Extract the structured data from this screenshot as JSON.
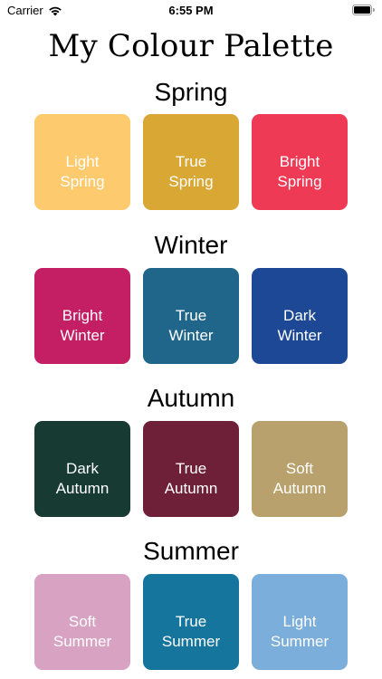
{
  "status_bar": {
    "carrier": "Carrier",
    "time": "6:55 PM",
    "icons": [
      "wifi-icon",
      "battery-icon"
    ]
  },
  "title": "My Colour Palette",
  "seasons": [
    {
      "name": "Spring",
      "swatches": [
        {
          "line1": "Light",
          "line2": "Spring",
          "color": "#FDCA6E"
        },
        {
          "line1": "True",
          "line2": "Spring",
          "color": "#D8A734"
        },
        {
          "line1": "Bright",
          "line2": "Spring",
          "color": "#EE3A55"
        }
      ]
    },
    {
      "name": "Winter",
      "swatches": [
        {
          "line1": "Bright",
          "line2": "Winter",
          "color": "#C41E64"
        },
        {
          "line1": "True",
          "line2": "Winter",
          "color": "#20668A"
        },
        {
          "line1": "Dark",
          "line2": "Winter",
          "color": "#1D4896"
        }
      ]
    },
    {
      "name": "Autumn",
      "swatches": [
        {
          "line1": "Dark",
          "line2": "Autumn",
          "color": "#173A33"
        },
        {
          "line1": "True",
          "line2": "Autumn",
          "color": "#6F2039"
        },
        {
          "line1": "Soft",
          "line2": "Autumn",
          "color": "#B8A16C"
        }
      ]
    },
    {
      "name": "Summer",
      "swatches": [
        {
          "line1": "Soft",
          "line2": "Summer",
          "color": "#D8A2C2"
        },
        {
          "line1": "True",
          "line2": "Summer",
          "color": "#15759D"
        },
        {
          "line1": "Light",
          "line2": "Summer",
          "color": "#7BAEDA"
        }
      ]
    }
  ]
}
